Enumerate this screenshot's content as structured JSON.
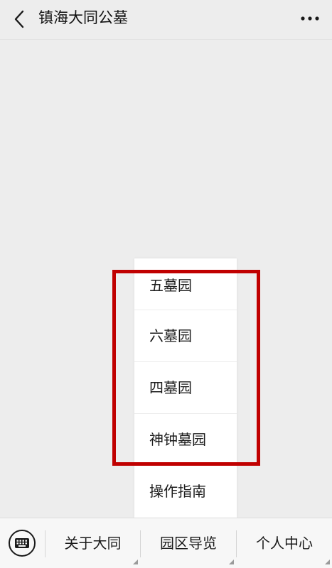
{
  "header": {
    "title": "镇海大同公墓",
    "back_icon": "chevron-left-icon",
    "more_icon": "more-dots-icon"
  },
  "submenu": {
    "items": [
      {
        "label": "五墓园"
      },
      {
        "label": "六墓园"
      },
      {
        "label": "四墓园"
      },
      {
        "label": "神钟墓园"
      },
      {
        "label": "操作指南"
      }
    ],
    "highlight_color": "#c00000"
  },
  "footer": {
    "keyboard_icon": "keyboard-icon",
    "tabs": [
      {
        "label": "关于大同"
      },
      {
        "label": "园区导览"
      },
      {
        "label": "个人中心"
      }
    ]
  }
}
